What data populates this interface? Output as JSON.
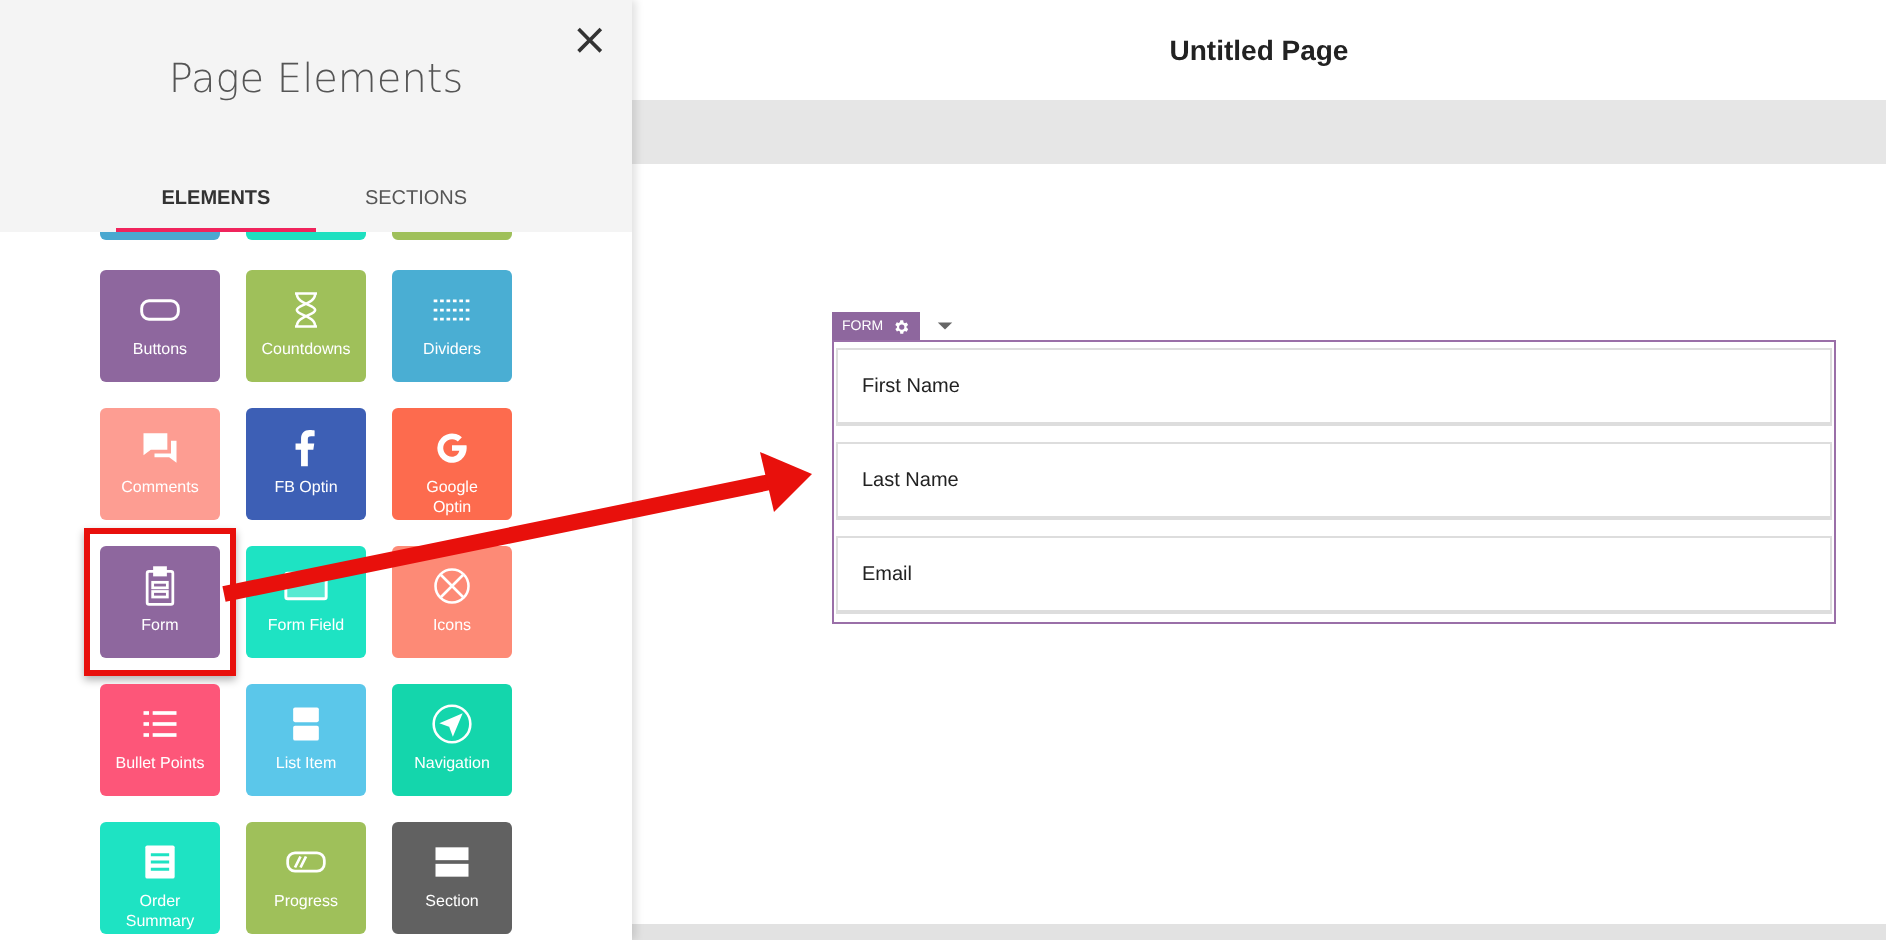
{
  "sidebar": {
    "title": "Page Elements",
    "close": "×",
    "tabs": [
      {
        "label": "ELEMENTS",
        "selected": true
      },
      {
        "label": "SECTIONS",
        "selected": false
      }
    ],
    "partial_tiles": [
      {
        "color": "#4aa8d0"
      },
      {
        "color": "#1ee0c0"
      },
      {
        "color": "#9fc05a"
      }
    ],
    "tiles": [
      {
        "label": "Buttons",
        "color": "#8e679e",
        "highlighted": false
      },
      {
        "label": "Countdowns",
        "color": "#9fc05a",
        "highlighted": false
      },
      {
        "label": "Dividers",
        "color": "#4aaed3",
        "highlighted": false
      },
      {
        "label": "Comments",
        "color": "#fd9d92",
        "highlighted": false
      },
      {
        "label": "FB Optin",
        "color": "#3d5fb5",
        "highlighted": false
      },
      {
        "label": "Google Optin",
        "color": "#fd6b4e",
        "highlighted": false
      },
      {
        "label": "Form",
        "color": "#8e679e",
        "highlighted": true
      },
      {
        "label": "Form Field",
        "color": "#1ee3c3",
        "highlighted": false
      },
      {
        "label": "Icons",
        "color": "#fd8a76",
        "highlighted": false
      },
      {
        "label": "Bullet Points",
        "color": "#fd5679",
        "highlighted": false
      },
      {
        "label": "List Item",
        "color": "#5bc7ea",
        "highlighted": false
      },
      {
        "label": "Navigation",
        "color": "#14d6ac",
        "highlighted": false
      },
      {
        "label": "Order Summary",
        "color": "#1ee3c3",
        "highlighted": false
      },
      {
        "label": "Progress",
        "color": "#9fc05a",
        "highlighted": false
      },
      {
        "label": "Section",
        "color": "#616161",
        "highlighted": false
      }
    ]
  },
  "page": {
    "title": "Untitled Page",
    "form": {
      "tag": "FORM",
      "fields": [
        {
          "placeholder": "First Name"
        },
        {
          "placeholder": "Last Name"
        },
        {
          "placeholder": "Email"
        }
      ]
    }
  }
}
